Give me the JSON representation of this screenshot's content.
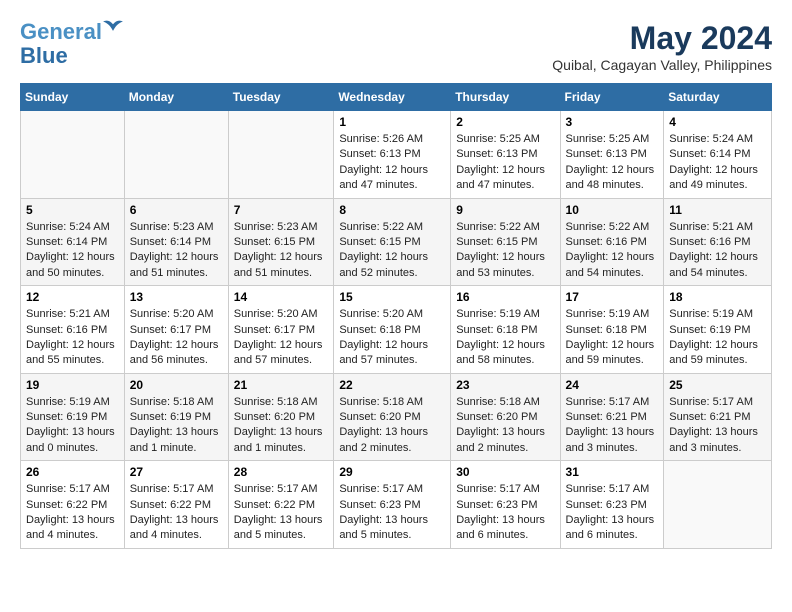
{
  "logo": {
    "line1": "General",
    "line2": "Blue"
  },
  "title": "May 2024",
  "subtitle": "Quibal, Cagayan Valley, Philippines",
  "days_header": [
    "Sunday",
    "Monday",
    "Tuesday",
    "Wednesday",
    "Thursday",
    "Friday",
    "Saturday"
  ],
  "weeks": [
    {
      "days": [
        {
          "num": "",
          "info": ""
        },
        {
          "num": "",
          "info": ""
        },
        {
          "num": "",
          "info": ""
        },
        {
          "num": "1",
          "info": "Sunrise: 5:26 AM\nSunset: 6:13 PM\nDaylight: 12 hours and 47 minutes."
        },
        {
          "num": "2",
          "info": "Sunrise: 5:25 AM\nSunset: 6:13 PM\nDaylight: 12 hours and 47 minutes."
        },
        {
          "num": "3",
          "info": "Sunrise: 5:25 AM\nSunset: 6:13 PM\nDaylight: 12 hours and 48 minutes."
        },
        {
          "num": "4",
          "info": "Sunrise: 5:24 AM\nSunset: 6:14 PM\nDaylight: 12 hours and 49 minutes."
        }
      ]
    },
    {
      "days": [
        {
          "num": "5",
          "info": "Sunrise: 5:24 AM\nSunset: 6:14 PM\nDaylight: 12 hours and 50 minutes."
        },
        {
          "num": "6",
          "info": "Sunrise: 5:23 AM\nSunset: 6:14 PM\nDaylight: 12 hours and 51 minutes."
        },
        {
          "num": "7",
          "info": "Sunrise: 5:23 AM\nSunset: 6:15 PM\nDaylight: 12 hours and 51 minutes."
        },
        {
          "num": "8",
          "info": "Sunrise: 5:22 AM\nSunset: 6:15 PM\nDaylight: 12 hours and 52 minutes."
        },
        {
          "num": "9",
          "info": "Sunrise: 5:22 AM\nSunset: 6:15 PM\nDaylight: 12 hours and 53 minutes."
        },
        {
          "num": "10",
          "info": "Sunrise: 5:22 AM\nSunset: 6:16 PM\nDaylight: 12 hours and 54 minutes."
        },
        {
          "num": "11",
          "info": "Sunrise: 5:21 AM\nSunset: 6:16 PM\nDaylight: 12 hours and 54 minutes."
        }
      ]
    },
    {
      "days": [
        {
          "num": "12",
          "info": "Sunrise: 5:21 AM\nSunset: 6:16 PM\nDaylight: 12 hours and 55 minutes."
        },
        {
          "num": "13",
          "info": "Sunrise: 5:20 AM\nSunset: 6:17 PM\nDaylight: 12 hours and 56 minutes."
        },
        {
          "num": "14",
          "info": "Sunrise: 5:20 AM\nSunset: 6:17 PM\nDaylight: 12 hours and 57 minutes."
        },
        {
          "num": "15",
          "info": "Sunrise: 5:20 AM\nSunset: 6:18 PM\nDaylight: 12 hours and 57 minutes."
        },
        {
          "num": "16",
          "info": "Sunrise: 5:19 AM\nSunset: 6:18 PM\nDaylight: 12 hours and 58 minutes."
        },
        {
          "num": "17",
          "info": "Sunrise: 5:19 AM\nSunset: 6:18 PM\nDaylight: 12 hours and 59 minutes."
        },
        {
          "num": "18",
          "info": "Sunrise: 5:19 AM\nSunset: 6:19 PM\nDaylight: 12 hours and 59 minutes."
        }
      ]
    },
    {
      "days": [
        {
          "num": "19",
          "info": "Sunrise: 5:19 AM\nSunset: 6:19 PM\nDaylight: 13 hours and 0 minutes."
        },
        {
          "num": "20",
          "info": "Sunrise: 5:18 AM\nSunset: 6:19 PM\nDaylight: 13 hours and 1 minute."
        },
        {
          "num": "21",
          "info": "Sunrise: 5:18 AM\nSunset: 6:20 PM\nDaylight: 13 hours and 1 minutes."
        },
        {
          "num": "22",
          "info": "Sunrise: 5:18 AM\nSunset: 6:20 PM\nDaylight: 13 hours and 2 minutes."
        },
        {
          "num": "23",
          "info": "Sunrise: 5:18 AM\nSunset: 6:20 PM\nDaylight: 13 hours and 2 minutes."
        },
        {
          "num": "24",
          "info": "Sunrise: 5:17 AM\nSunset: 6:21 PM\nDaylight: 13 hours and 3 minutes."
        },
        {
          "num": "25",
          "info": "Sunrise: 5:17 AM\nSunset: 6:21 PM\nDaylight: 13 hours and 3 minutes."
        }
      ]
    },
    {
      "days": [
        {
          "num": "26",
          "info": "Sunrise: 5:17 AM\nSunset: 6:22 PM\nDaylight: 13 hours and 4 minutes."
        },
        {
          "num": "27",
          "info": "Sunrise: 5:17 AM\nSunset: 6:22 PM\nDaylight: 13 hours and 4 minutes."
        },
        {
          "num": "28",
          "info": "Sunrise: 5:17 AM\nSunset: 6:22 PM\nDaylight: 13 hours and 5 minutes."
        },
        {
          "num": "29",
          "info": "Sunrise: 5:17 AM\nSunset: 6:23 PM\nDaylight: 13 hours and 5 minutes."
        },
        {
          "num": "30",
          "info": "Sunrise: 5:17 AM\nSunset: 6:23 PM\nDaylight: 13 hours and 6 minutes."
        },
        {
          "num": "31",
          "info": "Sunrise: 5:17 AM\nSunset: 6:23 PM\nDaylight: 13 hours and 6 minutes."
        },
        {
          "num": "",
          "info": ""
        }
      ]
    }
  ]
}
